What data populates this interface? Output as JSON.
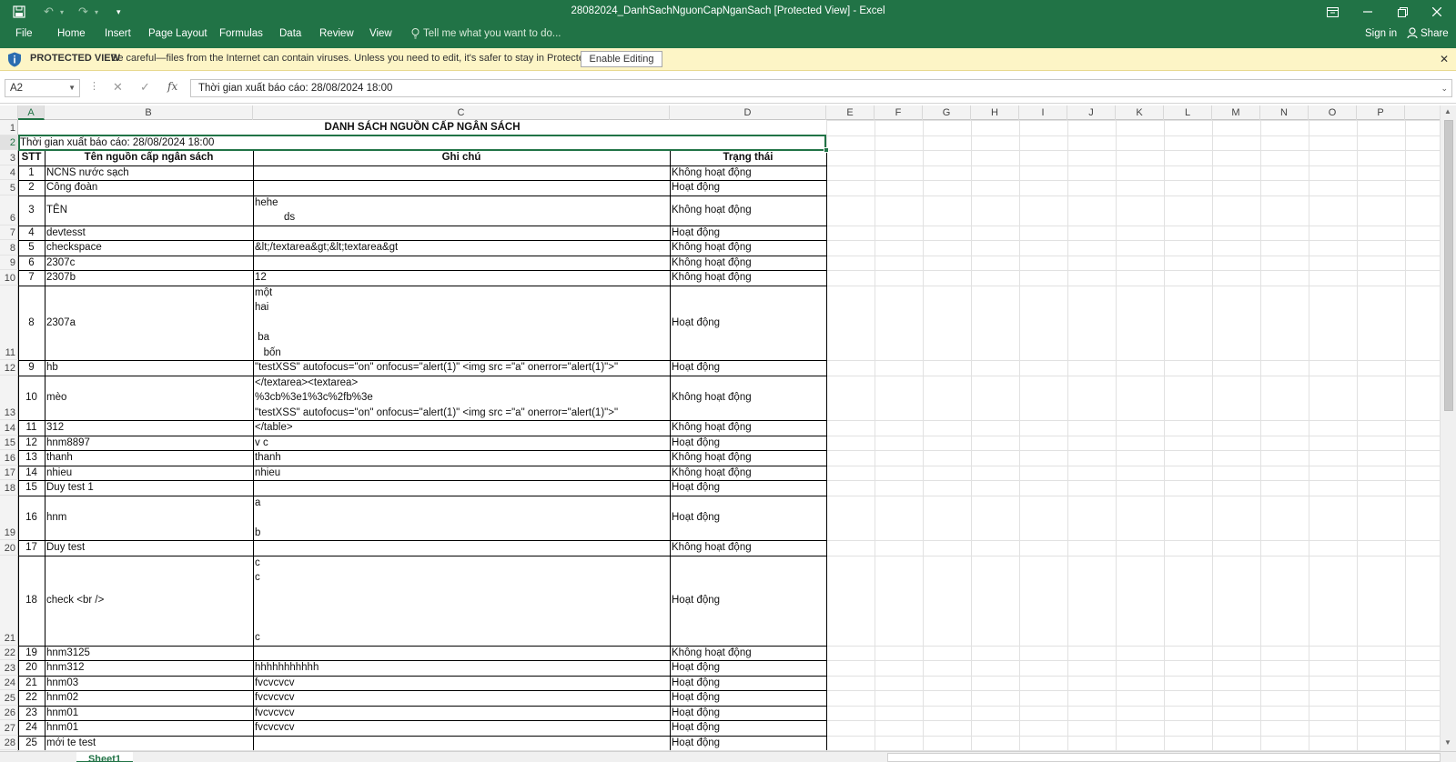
{
  "window": {
    "title": "28082024_DanhSachNguonCapNganSach  [Protected View] - Excel"
  },
  "ribbon": {
    "tabs": [
      "File",
      "Home",
      "Insert",
      "Page Layout",
      "Formulas",
      "Data",
      "Review",
      "View"
    ],
    "tell_me": "Tell me what you want to do...",
    "sign_in": "Sign in",
    "share": "Share"
  },
  "protected_view": {
    "label": "PROTECTED VIEW",
    "message": "Be careful—files from the Internet can contain viruses. Unless you need to edit, it's safer to stay in Protected View.",
    "enable_button": "Enable Editing"
  },
  "formula_bar": {
    "name_box": "A2",
    "formula": "Thời gian xuất báo cáo: 28/08/2024 18:00"
  },
  "columns": [
    "A",
    "B",
    "C",
    "D",
    "E",
    "F",
    "G",
    "H",
    "I",
    "J",
    "K",
    "L",
    "M",
    "N",
    "O",
    "P"
  ],
  "selected_column": "A",
  "row_numbers": [
    "1",
    "2",
    "3",
    "4",
    "5",
    "6",
    "7",
    "8",
    "9",
    "10",
    "11",
    "12",
    "13",
    "14",
    "15",
    "16",
    "17",
    "18",
    "19",
    "20",
    "21",
    "22",
    "23",
    "24",
    "25",
    "26",
    "27",
    "28"
  ],
  "selected_row": "2",
  "sheet": {
    "title": "DANH SÁCH NGUỒN CẤP NGÂN SÁCH",
    "export_time": "Thời gian xuất báo cáo: 28/08/2024 18:00",
    "headers": [
      "STT",
      "Tên nguồn cấp ngân sách",
      "Ghi chú",
      "Trạng thái"
    ],
    "records": [
      {
        "stt": "1",
        "name": "NCNS nước sạch",
        "note": "",
        "status": "Không hoạt động"
      },
      {
        "stt": "2",
        "name": "Công đoàn",
        "note": "",
        "status": "Hoạt động"
      },
      {
        "stt": "3",
        "name": "TÊN",
        "note": "hehe\n          ds",
        "status": "Không hoạt động"
      },
      {
        "stt": "4",
        "name": "devtesst",
        "note": "",
        "status": "Hoạt động"
      },
      {
        "stt": "5",
        "name": "checkspace",
        "note": "&lt;/textarea&gt;&lt;textarea&gt",
        "status": "Không hoạt động"
      },
      {
        "stt": "6",
        "name": "2307c",
        "note": "",
        "status": "Không hoạt động"
      },
      {
        "stt": "7",
        "name": "2307b",
        "note": "12",
        "status": "Không hoạt động"
      },
      {
        "stt": "8",
        "name": "2307a",
        "note": "một\nhai\n\n ba\n   bốn",
        "status": "Hoạt động"
      },
      {
        "stt": "9",
        "name": "hb",
        "note": "\"testXSS\" autofocus=\"on\" onfocus=\"alert(1)\" <img src =\"a\" onerror=\"alert(1)\">\"",
        "status": "Hoạt động"
      },
      {
        "stt": "10",
        "name": "mèo",
        "note": "</textarea><textarea>\n%3cb%3e1%3c%2fb%3e\n\"testXSS\" autofocus=\"on\" onfocus=\"alert(1)\" <img src =\"a\" onerror=\"alert(1)\">\"",
        "status": "Không hoạt động"
      },
      {
        "stt": "11",
        "name": "312",
        "note": "</table>",
        "status": "Không hoạt động"
      },
      {
        "stt": "12",
        "name": "hnm8897",
        "note": "v c",
        "status": "Hoạt động"
      },
      {
        "stt": "13",
        "name": "thanh",
        "note": "thanh",
        "status": "Không hoạt động"
      },
      {
        "stt": "14",
        "name": "nhieu",
        "note": "nhieu",
        "status": "Không hoạt động"
      },
      {
        "stt": "15",
        "name": "Duy test 1",
        "note": "",
        "status": "Hoạt động"
      },
      {
        "stt": "16",
        "name": "hnm",
        "note": "a\n\nb",
        "status": "Hoạt động"
      },
      {
        "stt": "17",
        "name": "Duy test",
        "note": "",
        "status": "Không hoạt động"
      },
      {
        "stt": "18",
        "name": "check <br />",
        "note": "c\nc\n\n\n\nc",
        "status": "Hoạt động"
      },
      {
        "stt": "19",
        "name": "hnm3125",
        "note": "",
        "status": "Không hoạt động"
      },
      {
        "stt": "20",
        "name": "hnm312",
        "note": "hhhhhhhhhhh",
        "status": "Hoạt động"
      },
      {
        "stt": "21",
        "name": "hnm03",
        "note": "fvcvcvcv",
        "status": "Hoạt động"
      },
      {
        "stt": "22",
        "name": "hnm02",
        "note": "fvcvcvcv",
        "status": "Hoạt động"
      },
      {
        "stt": "23",
        "name": "hnm01",
        "note": "fvcvcvcv",
        "status": "Hoạt động"
      },
      {
        "stt": "24",
        "name": "hnm01",
        "note": "fvcvcvcv",
        "status": "Hoạt động"
      },
      {
        "stt": "25",
        "name": "mới te test",
        "note": "",
        "status": "Hoạt động"
      }
    ]
  },
  "sheet_tabs": [
    "Sheet1"
  ],
  "colors": {
    "excel_green": "#217346",
    "protected_bar": "#fdf5c6",
    "shield_blue": "#2b6cb0"
  },
  "icons": [
    "save-icon",
    "undo-icon",
    "redo-icon",
    "customize-icon",
    "ribbon-display-icon",
    "minimize-icon",
    "restore-icon",
    "close-icon",
    "lightbulb-icon",
    "person-icon",
    "shield-icon",
    "cancel-icon",
    "enter-icon",
    "function-icon"
  ]
}
